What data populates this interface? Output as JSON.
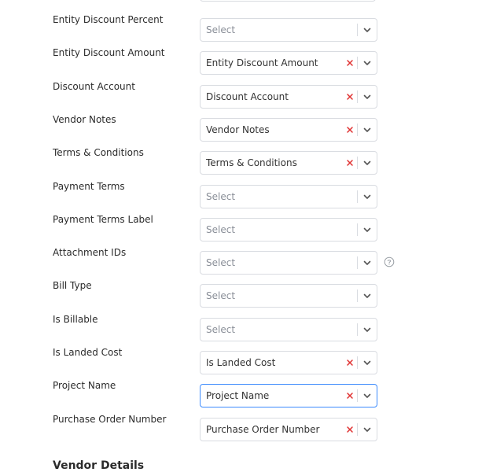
{
  "fields": [
    {
      "label": "Entity Discount Percent",
      "value": "",
      "placeholder": "Select"
    },
    {
      "label": "Entity Discount Amount",
      "value": "Entity Discount Amount",
      "placeholder": "Select"
    },
    {
      "label": "Discount Account",
      "value": "Discount Account",
      "placeholder": "Select"
    },
    {
      "label": "Vendor Notes",
      "value": "Vendor Notes",
      "placeholder": "Select"
    },
    {
      "label": "Terms & Conditions",
      "value": "Terms & Conditions",
      "placeholder": "Select"
    },
    {
      "label": "Payment Terms",
      "value": "",
      "placeholder": "Select"
    },
    {
      "label": "Payment Terms Label",
      "value": "",
      "placeholder": "Select"
    },
    {
      "label": "Attachment IDs",
      "value": "",
      "placeholder": "Select",
      "help": true
    },
    {
      "label": "Bill Type",
      "value": "",
      "placeholder": "Select"
    },
    {
      "label": "Is Billable",
      "value": "",
      "placeholder": "Select"
    },
    {
      "label": "Is Landed Cost",
      "value": "Is Landed Cost",
      "placeholder": "Select"
    },
    {
      "label": "Project Name",
      "value": "Project Name",
      "placeholder": "Select",
      "focused": true
    },
    {
      "label": "Purchase Order Number",
      "value": "Purchase Order Number",
      "placeholder": "Select"
    }
  ],
  "section_heading": "Vendor Details",
  "icons": {
    "clear": "close-icon",
    "dropdown": "chevron-down-icon",
    "help": "question-circle-icon"
  },
  "colors": {
    "clear": "#e03131",
    "focus_border": "#3d8bfd",
    "border": "#d9dce1",
    "placeholder": "#8a8f98"
  }
}
